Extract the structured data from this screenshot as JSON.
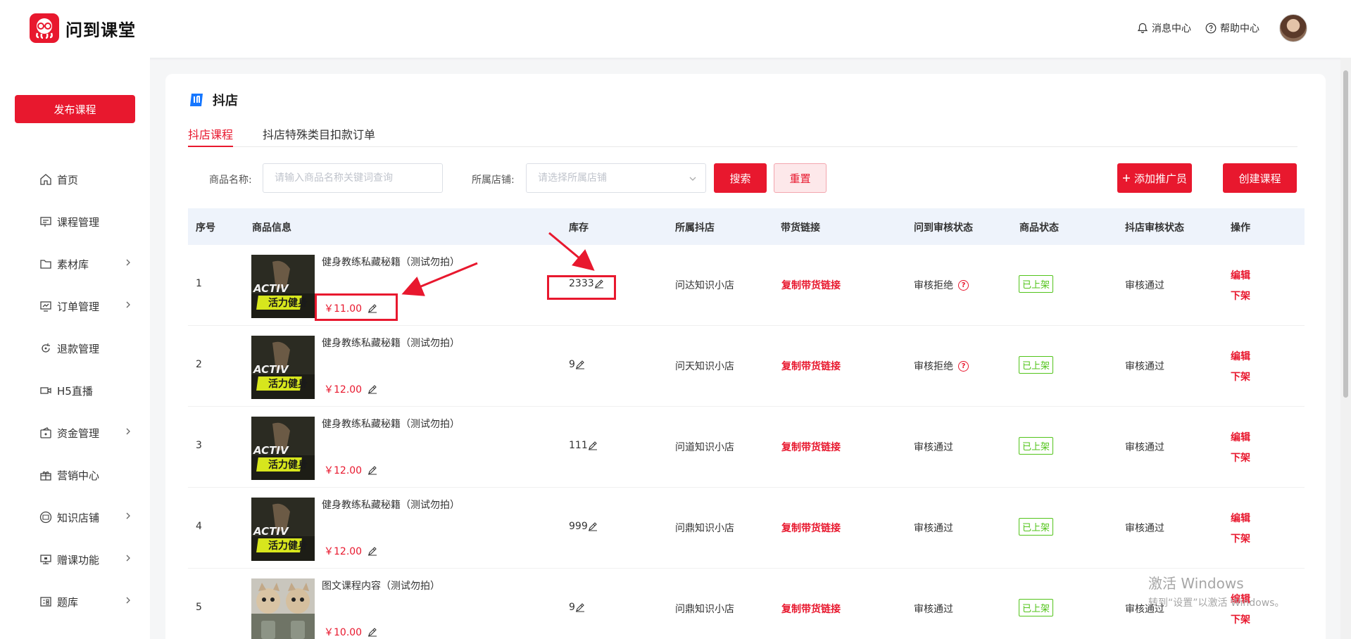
{
  "header": {
    "logo_text": "问到课堂",
    "messages_label": "消息中心",
    "help_label": "帮助中心"
  },
  "sidebar": {
    "publish_label": "发布课程",
    "items": [
      {
        "label": "首页",
        "icon": "home-icon",
        "has_arrow": false
      },
      {
        "label": "课程管理",
        "icon": "course-icon",
        "has_arrow": false
      },
      {
        "label": "素材库",
        "icon": "folder-icon",
        "has_arrow": true
      },
      {
        "label": "订单管理",
        "icon": "order-icon",
        "has_arrow": true
      },
      {
        "label": "退款管理",
        "icon": "refund-icon",
        "has_arrow": false
      },
      {
        "label": "H5直播",
        "icon": "video-icon",
        "has_arrow": false
      },
      {
        "label": "资金管理",
        "icon": "wallet-icon",
        "has_arrow": true
      },
      {
        "label": "营销中心",
        "icon": "gift-icon",
        "has_arrow": false
      },
      {
        "label": "知识店铺",
        "icon": "shop-icon",
        "has_arrow": true
      },
      {
        "label": "赠课功能",
        "icon": "present-icon",
        "has_arrow": true
      },
      {
        "label": "题库",
        "icon": "question-bank-icon",
        "has_arrow": true
      }
    ]
  },
  "page": {
    "title": "抖店",
    "tabs": [
      "抖店课程",
      "抖店特殊类目扣款订单"
    ],
    "active_tab": 0
  },
  "filters": {
    "name_label": "商品名称:",
    "name_placeholder": "请输入商品名称关键词查询",
    "shop_label": "所属店铺:",
    "shop_placeholder": "请选择所属店铺",
    "search_label": "搜索",
    "reset_label": "重置",
    "add_promoter_label": "添加推广员",
    "create_course_label": "创建课程"
  },
  "table": {
    "columns": [
      "序号",
      "商品信息",
      "库存",
      "所属抖店",
      "带货链接",
      "问到审核状态",
      "商品状态",
      "抖店审核状态",
      "操作"
    ],
    "copy_link_label": "复制带货链接",
    "edit_label": "编辑",
    "offline_label": "下架",
    "rows": [
      {
        "index": "1",
        "name": "健身教练私藏秘籍（测试勿拍）",
        "price": "￥11.00",
        "stock": "2333",
        "shop": "问达知识小店",
        "audit": "审核拒绝",
        "audit_rejected": true,
        "status": "已上架",
        "dd_audit": "审核通过",
        "thumb": "fitness"
      },
      {
        "index": "2",
        "name": "健身教练私藏秘籍（测试勿拍）",
        "price": "￥12.00",
        "stock": "9",
        "shop": "问天知识小店",
        "audit": "审核拒绝",
        "audit_rejected": true,
        "status": "已上架",
        "dd_audit": "审核通过",
        "thumb": "fitness"
      },
      {
        "index": "3",
        "name": "健身教练私藏秘籍（测试勿拍）",
        "price": "￥12.00",
        "stock": "111",
        "shop": "问道知识小店",
        "audit": "审核通过",
        "audit_rejected": false,
        "status": "已上架",
        "dd_audit": "审核通过",
        "thumb": "fitness"
      },
      {
        "index": "4",
        "name": "健身教练私藏秘籍（测试勿拍）",
        "price": "￥12.00",
        "stock": "999",
        "shop": "问鼎知识小店",
        "audit": "审核通过",
        "audit_rejected": false,
        "status": "已上架",
        "dd_audit": "审核通过",
        "thumb": "fitness"
      },
      {
        "index": "5",
        "name": "图文课程内容（测试勿拍）",
        "price": "￥10.00",
        "stock": "9",
        "shop": "问鼎知识小店",
        "audit": "审核通过",
        "audit_rejected": false,
        "status": "已上架",
        "dd_audit": "审核通过",
        "thumb": "cats"
      }
    ]
  },
  "thumbnail_text": {
    "top": "ACTIV",
    "highlight": "活力健身"
  },
  "watermark": {
    "line1": "激活 Windows",
    "line2": "转到“设置”以激活 Windows。"
  },
  "colors": {
    "brand": "#e8182e",
    "success": "#52c41a",
    "table_header_bg": "#eef3fb"
  }
}
